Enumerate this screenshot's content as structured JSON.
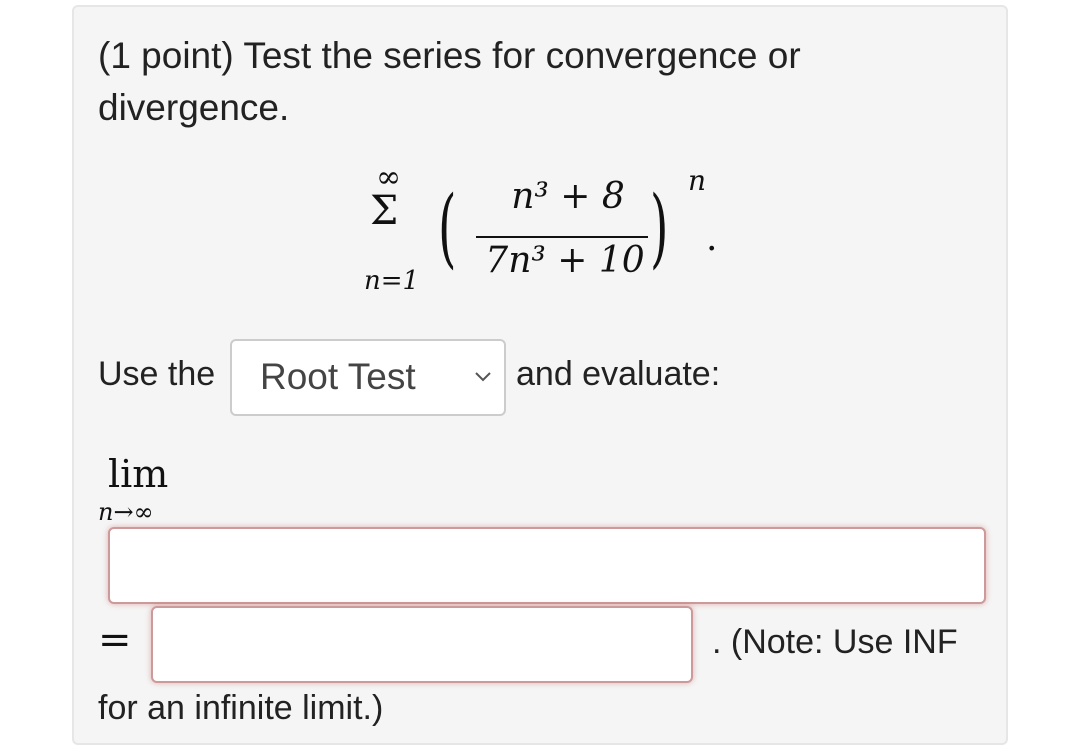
{
  "problem": {
    "text": "(1 point) Test the series for convergence or divergence."
  },
  "series": {
    "sum_upper": "∞",
    "sum_symbol": "Σ",
    "sum_lower": "n=1",
    "numerator": "n³ + 8",
    "denominator": "7n³ + 10",
    "exponent": "n",
    "trailing": "."
  },
  "prompt": {
    "before": "Use the",
    "after": "and evaluate:"
  },
  "test_select": {
    "selected": "Root Test"
  },
  "limit": {
    "word": "lim",
    "subscript": "n→∞"
  },
  "answers": {
    "limit_value": "",
    "result_value": ""
  },
  "equals_sign": "=",
  "note": {
    "line1": ". (Note: Use INF",
    "line2": "for an infinite limit.)"
  },
  "colors": {
    "card_bg": "#f5f5f5",
    "input_border_error": "#cc9a9a"
  }
}
